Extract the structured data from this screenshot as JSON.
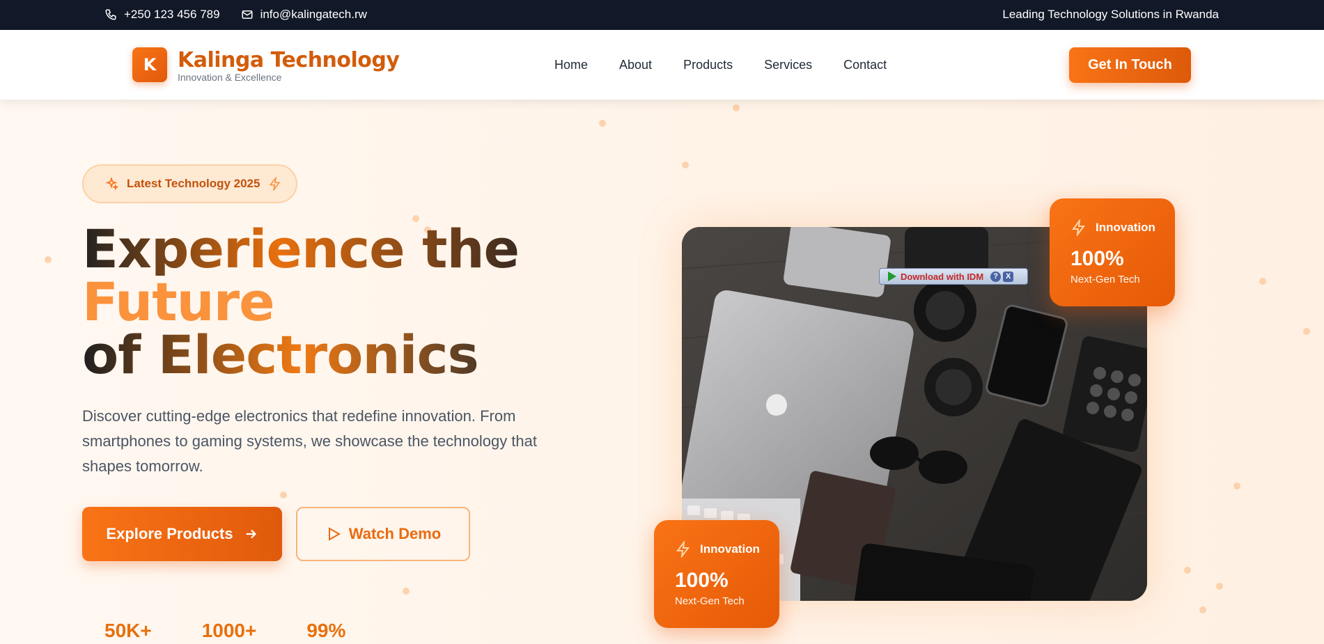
{
  "topbar": {
    "phone": "+250 123 456 789",
    "email": "info@kalingatech.rw",
    "tagline": "Leading Technology Solutions in Rwanda"
  },
  "header": {
    "logo_letter": "K",
    "brand_name": "Kalinga Technology",
    "brand_sub": "Innovation & Excellence",
    "nav": [
      "Home",
      "About",
      "Products",
      "Services",
      "Contact"
    ],
    "cta": "Get In Touch"
  },
  "hero": {
    "badge": "Latest Technology 2025",
    "headline_line1": "Experience the",
    "headline_line2": "Future",
    "headline_line3": "of Electronics",
    "description": "Discover cutting-edge electronics that redefine innovation. From smartphones to gaming systems, we showcase the technology that shapes tomorrow.",
    "primary_button": "Explore Products",
    "secondary_button": "Watch Demo",
    "stats": [
      "50K+",
      "1000+",
      "99%"
    ]
  },
  "cards": [
    {
      "title": "Innovation",
      "value": "100%",
      "subtitle": "Next-Gen Tech"
    },
    {
      "title": "Innovation",
      "value": "100%",
      "subtitle": "Next-Gen Tech"
    }
  ],
  "idm_overlay": {
    "label": "Download with IDM",
    "help": "?",
    "close": "X"
  },
  "colors": {
    "accent": "#f97316",
    "accent_dark": "#e05a0c",
    "topbar_bg": "#111827",
    "hero_bg": "#fff8f1"
  }
}
